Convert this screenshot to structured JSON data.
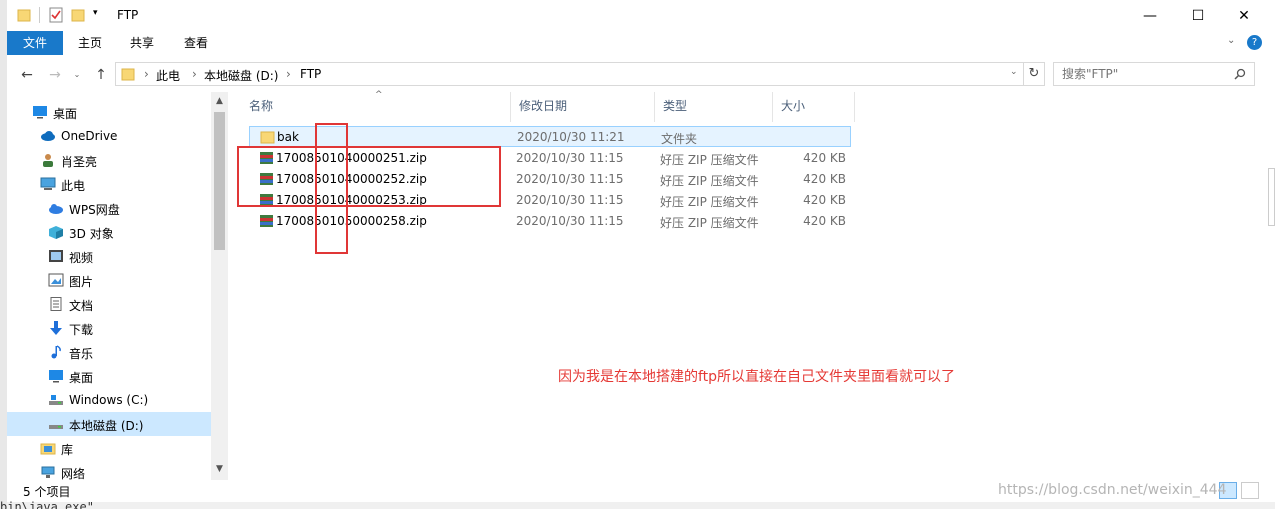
{
  "window": {
    "title": "FTP"
  },
  "ribbon": {
    "tabs": [
      "文件",
      "主页",
      "共享",
      "查看"
    ]
  },
  "address": {
    "crumbs": [
      "此电",
      "本地磁盘 (D:)",
      "FTP"
    ],
    "search_placeholder": "搜索\"FTP\""
  },
  "sidebar": {
    "items": [
      {
        "label": "桌面",
        "icon": "desktop-icon"
      },
      {
        "label": "OneDrive",
        "icon": "cloud-icon"
      },
      {
        "label": "肖圣亮",
        "icon": "user-icon"
      },
      {
        "label": "此电",
        "icon": "computer-icon"
      },
      {
        "label": "WPS网盘",
        "icon": "wps-cloud-icon"
      },
      {
        "label": "3D 对象",
        "icon": "cube-icon"
      },
      {
        "label": "视频",
        "icon": "video-icon"
      },
      {
        "label": "图片",
        "icon": "image-icon"
      },
      {
        "label": "文档",
        "icon": "document-icon"
      },
      {
        "label": "下载",
        "icon": "download-icon"
      },
      {
        "label": "音乐",
        "icon": "music-icon"
      },
      {
        "label": "桌面",
        "icon": "desktop-icon"
      },
      {
        "label": "Windows (C:)",
        "icon": "drive-icon"
      },
      {
        "label": "本地磁盘 (D:)",
        "icon": "drive-icon"
      },
      {
        "label": "库",
        "icon": "library-icon"
      },
      {
        "label": "网络",
        "icon": "network-icon"
      }
    ]
  },
  "columns": [
    "名称",
    "修改日期",
    "类型",
    "大小"
  ],
  "files": [
    {
      "name": "bak",
      "date": "2020/10/30 11:21",
      "type": "文件夹",
      "size": ""
    },
    {
      "name": "170085010400002​51.zip",
      "date": "2020/10/30 11:15",
      "type": "好压 ZIP 压缩文件",
      "size": "420 KB"
    },
    {
      "name": "17008501040000252.zip",
      "date": "2020/10/30 11:15",
      "type": "好压 ZIP 压缩文件",
      "size": "420 KB"
    },
    {
      "name": "17008501040000253.zip",
      "date": "2020/10/30 11:15",
      "type": "好压 ZIP 压缩文件",
      "size": "420 KB"
    },
    {
      "name": "17008501050000258.zip",
      "date": "2020/10/30 11:15",
      "type": "好压 ZIP 压缩文件",
      "size": "420 KB"
    }
  ],
  "status": {
    "count": "5 个项目"
  },
  "annotation": {
    "text": "因为我是在本地搭建的ftp所以直接在自己文件夹里面看就可以了"
  },
  "watermark": "https://blog.csdn.net/weixin_444",
  "background_text": "bin\\java.exe\" ...",
  "colors": {
    "accent": "#1979ca",
    "annotation": "#e03636",
    "selection": "#cce8ff"
  }
}
